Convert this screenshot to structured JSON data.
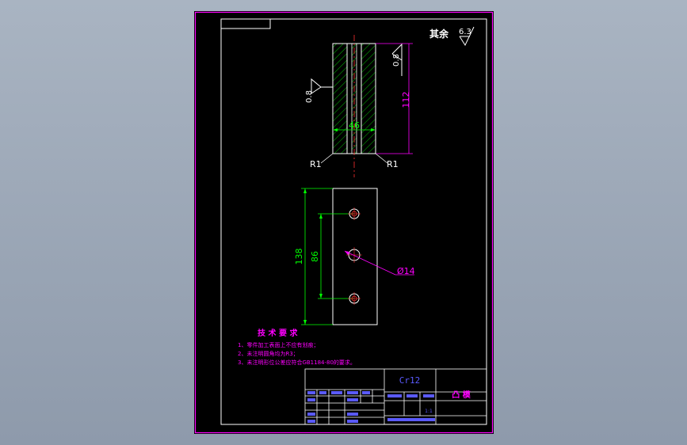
{
  "surface_note": {
    "label": "其余",
    "value": "6.3"
  },
  "side_view": {
    "roughness_right": "0.8",
    "roughness_left": "0.8",
    "dim_height": "112",
    "dim_width": "46",
    "radius_left": "R1",
    "radius_right": "R1"
  },
  "top_view": {
    "dim_overall": "138",
    "dim_holes": "86",
    "hole_dia": "Ø14"
  },
  "tech_requirements": {
    "title": "技 术 要 求",
    "items": [
      "1、零件加工表面上不应有划痕；",
      "2、未注明圆角均为R3；",
      "3、未注明形位公差应符合GB1184-80的要求。"
    ]
  },
  "title_block": {
    "material": "Cr12",
    "part_name": "凸 模",
    "scale": "1:1"
  },
  "colors": {
    "frame": "#ff00ff",
    "geometry": "#ffffff",
    "dimension": "#00ff00",
    "text_blue": "#5a5aff",
    "hatch": "#00c000",
    "center": "#ff3030",
    "background": "#000000"
  }
}
